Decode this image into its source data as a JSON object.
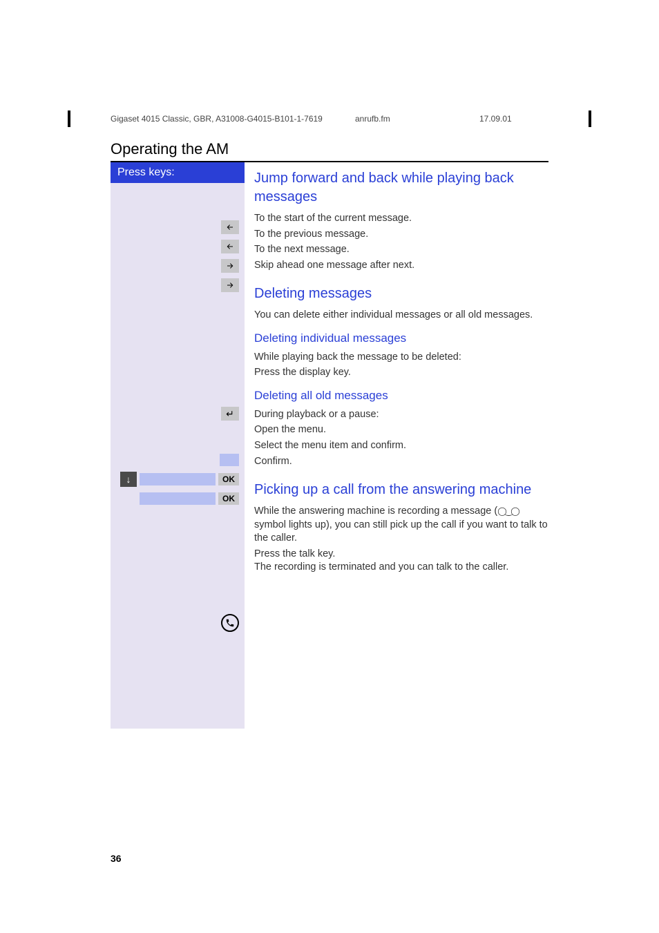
{
  "meta": {
    "doc_id": "Gigaset 4015 Classic, GBR, A31008-G4015-B101-1-7619",
    "file": "anrufb.fm",
    "date": "17.09.01"
  },
  "section_title": "Operating the AM",
  "sidebar_header": "Press keys:",
  "labels": {
    "ok": "OK",
    "down_arrow": "↓",
    "enter": "↵"
  },
  "h_jump": "Jump forward and back while playing back messages",
  "t_to_start": "To the start of the current message.",
  "t_to_prev": "To the previous message.",
  "t_to_next": "To the next message.",
  "t_skip_ahead": "Skip ahead one message after next.",
  "h_delete": "Deleting messages",
  "t_delete_intro": "You can delete either individual messages or all old messages.",
  "h_delete_indiv": "Deleting individual messages",
  "t_del_indiv_1": "While playing back the message to be deleted:",
  "t_del_indiv_2": "Press the display key.",
  "h_delete_all": "Deleting all old messages",
  "t_del_all_1": "During playback or a pause:",
  "t_del_all_2": "Open the menu.",
  "t_del_all_3": "Select the menu item and confirm.",
  "t_del_all_4": "Confirm.",
  "h_pickup": "Picking up a call from the answering machine",
  "t_pickup_1a": "While the answering machine is recording a message (",
  "t_pickup_1b": " symbol lights up), you can still pick up the call if you want to talk to the caller.",
  "t_pickup_2": "Press the talk key.\nThe recording is terminated and you can talk to the caller.",
  "tape_symbol": "◯‿◯",
  "page_number": "36"
}
